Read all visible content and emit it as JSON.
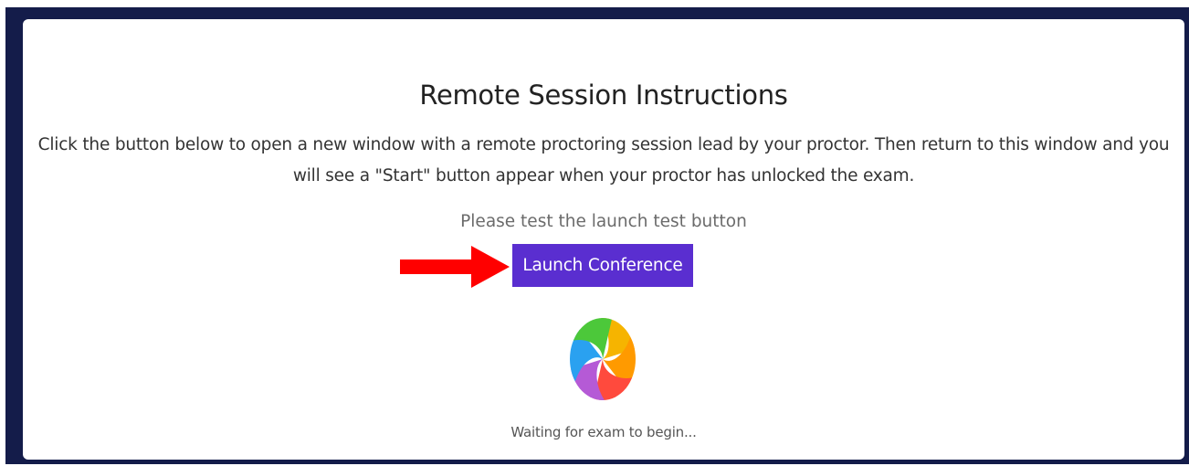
{
  "session": {
    "title": "Remote Session Instructions",
    "instructions": "Click the button below to open a new window with a remote proctoring session lead by your proctor. Then return to this window and you will see a \"Start\" button appear when your proctor has unlocked the exam.",
    "test_note": "Please test the launch test button",
    "launch_label": "Launch Conference",
    "waiting_text": "Waiting for exam to begin..."
  },
  "colors": {
    "frame": "#141c4a",
    "button": "#5a2ed0",
    "arrow": "#ff0000"
  },
  "icons": {
    "pointer": "red-arrow-icon",
    "loading": "spinning-wheel-icon"
  }
}
